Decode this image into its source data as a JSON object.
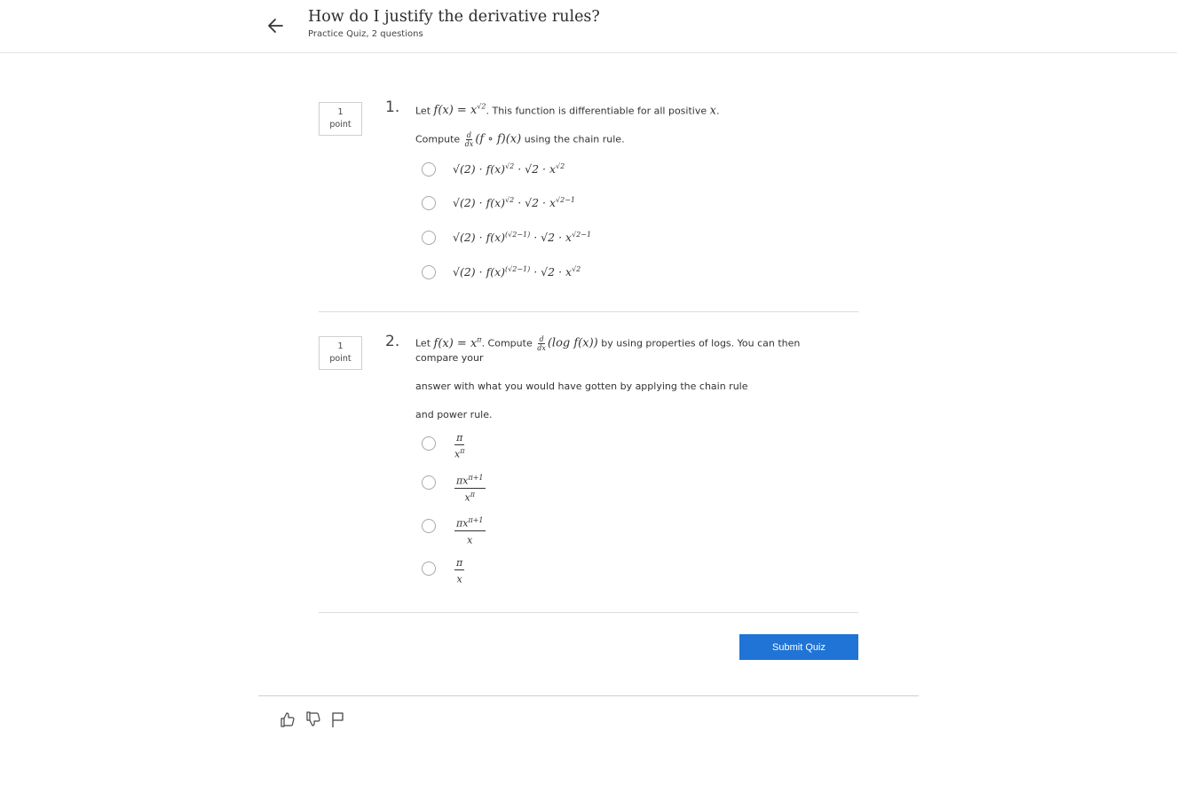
{
  "header": {
    "title": "How do I justify the derivative rules?",
    "subtitle": "Practice Quiz, 2 questions",
    "back_icon": "arrow-left-icon"
  },
  "questions": [
    {
      "number": "1.",
      "points": [
        "1",
        "point"
      ],
      "prompt_parts": [
        "Let",
        "f(x) = x",
        "√2",
        ". This function is differentiable for all positive",
        "x",
        "."
      ],
      "compute_parts": [
        "Compute",
        "d",
        "dx",
        "(f ∘ f)(x)",
        "using the chain rule."
      ],
      "options": [
        {
          "main": "√(2) · f(x)",
          "e1": "√2",
          "mid": " · √2 · x",
          "e2": "√2"
        },
        {
          "main": "√(2) · f(x)",
          "e1": "√2",
          "mid": " · √2 · x",
          "e2": "√2−1"
        },
        {
          "main": "√(2) · f(x)",
          "e1": "(√2−1)",
          "mid": " · √2 · x",
          "e2": "√2−1"
        },
        {
          "main": "√(2) · f(x)",
          "e1": "(√2−1)",
          "mid": " · √2 · x",
          "e2": "√2"
        }
      ]
    },
    {
      "number": "2.",
      "points": [
        "1",
        "point"
      ],
      "prompt_parts": [
        "Let",
        "f(x) = x",
        "π",
        ". Compute",
        "d",
        "dx",
        "(log f(x))",
        "by using properties of logs. You can then"
      ],
      "line2": "compare your",
      "line3": "answer with what you would have gotten by applying the chain rule",
      "line4": "and power rule.",
      "options": [
        {
          "num": "π",
          "den_base": "x",
          "den_exp": "π"
        },
        {
          "num_base": "πx",
          "num_exp": "π+1",
          "den_base": "x",
          "den_exp": "π"
        },
        {
          "num_base": "πx",
          "num_exp": "π+1",
          "den_base": "x",
          "den_exp": ""
        },
        {
          "num": "π",
          "den_base": "x",
          "den_exp": ""
        }
      ]
    }
  ],
  "submit_label": "Submit Quiz",
  "footer_icons": [
    "thumbs-up-icon",
    "thumbs-down-icon",
    "flag-icon"
  ]
}
